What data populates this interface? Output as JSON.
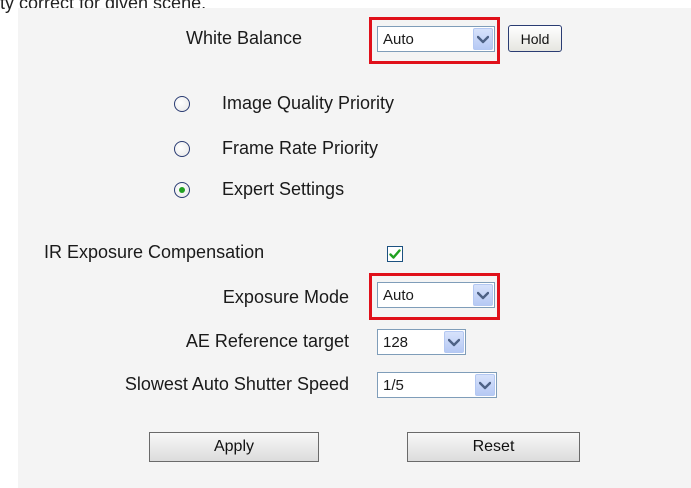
{
  "caption_fragment": "ty correct for given scene.",
  "white_balance": {
    "label": "White Balance",
    "value": "Auto",
    "hold_label": "Hold"
  },
  "priority_options": [
    {
      "label": "Image Quality Priority",
      "selected": false
    },
    {
      "label": "Frame Rate Priority",
      "selected": false
    },
    {
      "label": "Expert Settings",
      "selected": true
    }
  ],
  "ir_exposure": {
    "label": "IR Exposure Compensation",
    "checked": true
  },
  "exposure_mode": {
    "label": "Exposure Mode",
    "value": "Auto"
  },
  "ae_reference": {
    "label": "AE Reference target",
    "value": "128"
  },
  "shutter": {
    "label": "Slowest Auto Shutter Speed",
    "value": "1/5"
  },
  "buttons": {
    "apply": "Apply",
    "reset": "Reset"
  },
  "colors": {
    "highlight": "#e0101a",
    "radio_selected": "#21a121",
    "checkmark": "#21a121",
    "panel_bg": "#f4f4f4"
  },
  "icons": {
    "dropdown": "chevron-down-icon",
    "check": "check-icon"
  }
}
